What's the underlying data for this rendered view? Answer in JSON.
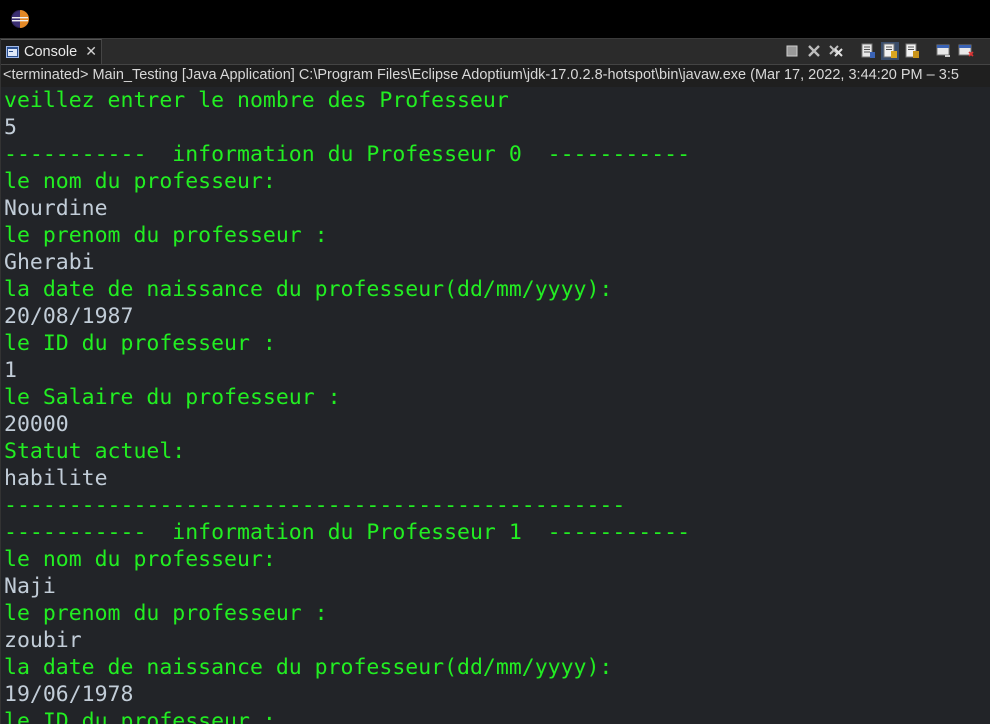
{
  "window": {
    "icon": "eclipse-logo-icon"
  },
  "view_tab": {
    "label": "Console",
    "icon": "console-icon",
    "close_icon": "close-icon"
  },
  "toolbar": [
    {
      "name": "terminate-icon"
    },
    {
      "name": "remove-launch-icon"
    },
    {
      "name": "remove-all-terminated-icon"
    },
    {
      "name": "scroll-lock-icon"
    },
    {
      "name": "show-on-stdout-icon"
    },
    {
      "name": "show-on-stderr-icon"
    },
    {
      "name": "pin-console-icon"
    },
    {
      "name": "open-console-icon"
    }
  ],
  "status": "<terminated> Main_Testing [Java Application] C:\\Program Files\\Eclipse Adoptium\\jdk-17.0.2.8-hotspot\\bin\\javaw.exe  (Mar 17, 2022, 3:44:20 PM – 3:5",
  "colors": {
    "output": "#22ee22",
    "input": "#c2cdd8",
    "background": "#222428"
  },
  "console_lines": [
    {
      "text": "veillez entrer le nombre des Professeur",
      "kind": "out"
    },
    {
      "text": "5",
      "kind": "in"
    },
    {
      "text": "-----------  information du Professeur 0  -----------",
      "kind": "out"
    },
    {
      "text": "le nom du professeur:",
      "kind": "out"
    },
    {
      "text": "Nourdine",
      "kind": "in"
    },
    {
      "text": "le prenom du professeur :",
      "kind": "out"
    },
    {
      "text": "Gherabi",
      "kind": "in"
    },
    {
      "text": "la date de naissance du professeur(dd/mm/yyyy):",
      "kind": "out"
    },
    {
      "text": "20/08/1987",
      "kind": "in"
    },
    {
      "text": "le ID du professeur :",
      "kind": "out"
    },
    {
      "text": "1",
      "kind": "in"
    },
    {
      "text": "le Salaire du professeur :",
      "kind": "out"
    },
    {
      "text": "20000",
      "kind": "in"
    },
    {
      "text": "Statut actuel:",
      "kind": "out"
    },
    {
      "text": "habilite",
      "kind": "in"
    },
    {
      "text": "------------------------------------------------",
      "kind": "out"
    },
    {
      "text": "-----------  information du Professeur 1  -----------",
      "kind": "out"
    },
    {
      "text": "le nom du professeur:",
      "kind": "out"
    },
    {
      "text": "Naji",
      "kind": "in"
    },
    {
      "text": "le prenom du professeur :",
      "kind": "out"
    },
    {
      "text": "zoubir",
      "kind": "in"
    },
    {
      "text": "la date de naissance du professeur(dd/mm/yyyy):",
      "kind": "out"
    },
    {
      "text": "19/06/1978",
      "kind": "in"
    },
    {
      "text": "le ID du professeur :",
      "kind": "out"
    }
  ]
}
